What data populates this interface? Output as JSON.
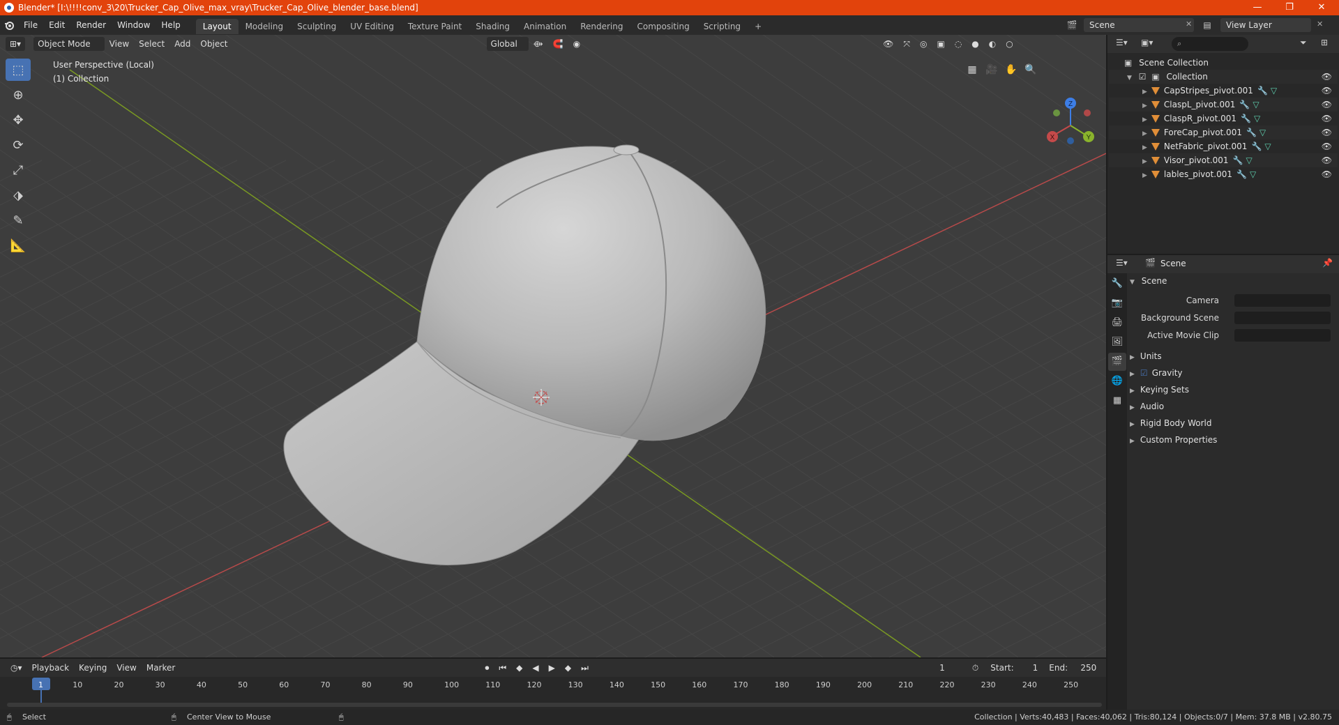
{
  "window": {
    "title": "Blender* [I:\\!!!!conv_3\\20\\Trucker_Cap_Olive_max_vray\\Trucker_Cap_Olive_blender_base.blend]",
    "minimize": "—",
    "maximize": "❐",
    "close": "✕"
  },
  "menu": [
    "File",
    "Edit",
    "Render",
    "Window",
    "Help"
  ],
  "workspaces": [
    "Layout",
    "Modeling",
    "Sculpting",
    "UV Editing",
    "Texture Paint",
    "Shading",
    "Animation",
    "Rendering",
    "Compositing",
    "Scripting"
  ],
  "active_workspace": "Layout",
  "add_workspace": "+",
  "scene_name": "Scene",
  "view_layer": "View Layer",
  "viewport": {
    "mode": "Object Mode",
    "menus": [
      "View",
      "Select",
      "Add",
      "Object"
    ],
    "orientation": "Global",
    "info_line1": "User Perspective (Local)",
    "info_line2": "(1) Collection",
    "gizmo_axes": {
      "x": "X",
      "y": "Y",
      "z": "Z"
    },
    "colors": {
      "x_axis": "#c44a4a",
      "y_axis": "#8ab32c",
      "z_axis": "#3d7ee6",
      "background": "#3d3d3d",
      "grid": "#474747"
    }
  },
  "outliner": {
    "root": "Scene Collection",
    "collection": "Collection",
    "objects": [
      "CapStripes_pivot.001",
      "ClaspL_pivot.001",
      "ClaspR_pivot.001",
      "ForeCap_pivot.001",
      "NetFabric_pivot.001",
      "Visor_pivot.001",
      "lables_pivot.001"
    ]
  },
  "properties": {
    "header": "Scene",
    "panel": "Scene",
    "camera_label": "Camera",
    "background_scene_label": "Background Scene",
    "active_movie_clip_label": "Active Movie Clip",
    "sections": [
      "Units",
      "Gravity",
      "Keying Sets",
      "Audio",
      "Rigid Body World",
      "Custom Properties"
    ],
    "gravity_checked": true
  },
  "timeline": {
    "menus": [
      "Playback",
      "Keying",
      "View",
      "Marker"
    ],
    "current_frame": "1",
    "start_label": "Start:",
    "start": "1",
    "end_label": "End:",
    "end": "250",
    "ticks": [
      "1",
      "10",
      "20",
      "30",
      "40",
      "50",
      "60",
      "70",
      "80",
      "90",
      "100",
      "110",
      "120",
      "130",
      "140",
      "150",
      "160",
      "170",
      "180",
      "190",
      "200",
      "210",
      "220",
      "230",
      "240",
      "250"
    ]
  },
  "statusbar": {
    "left_action": "Select",
    "middle_action": "Center View to Mouse",
    "stats": "Collection | Verts:40,483 | Faces:40,062 | Tris:80,124 | Objects:0/7 | Mem: 37.8 MB | v2.80.75"
  }
}
